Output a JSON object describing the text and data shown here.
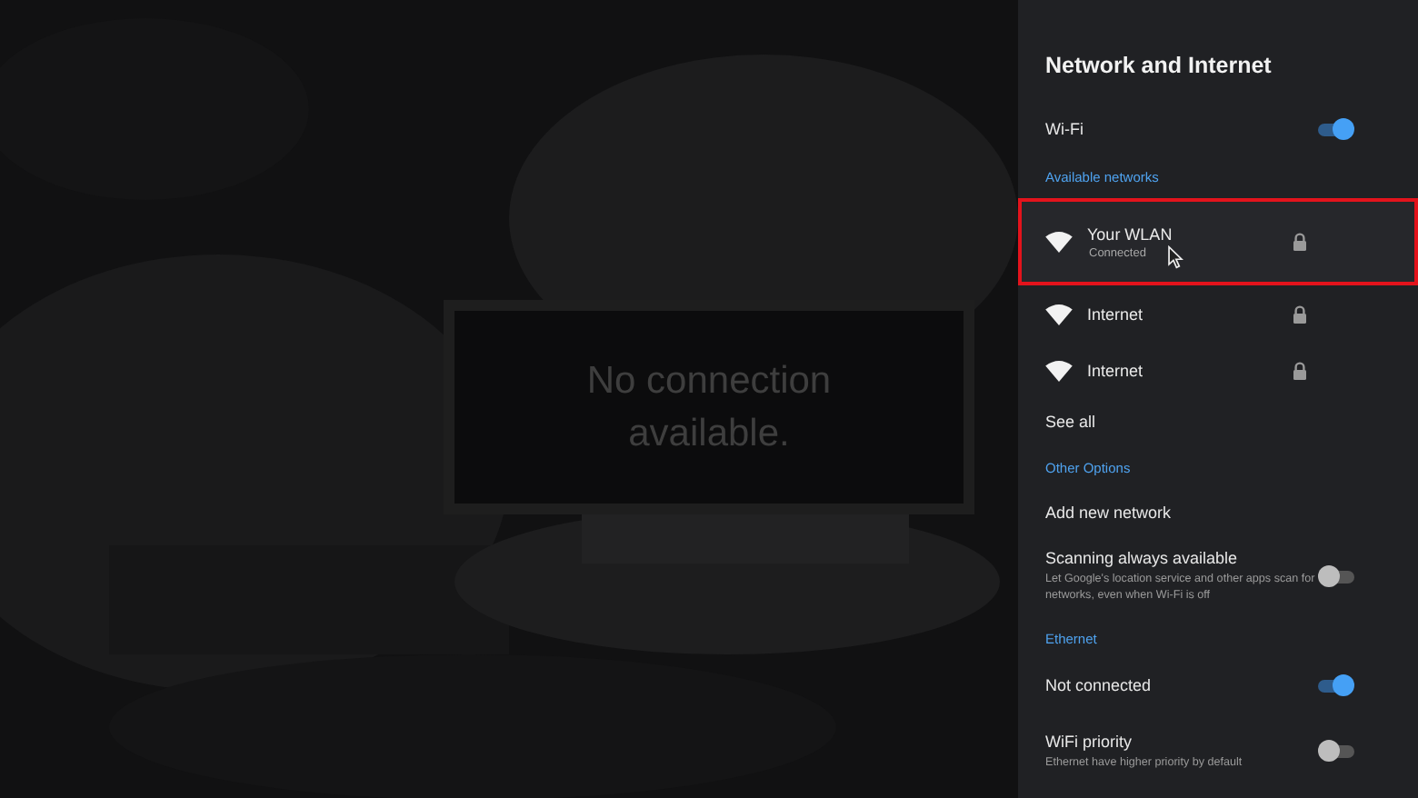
{
  "message": "No connection available.",
  "panel": {
    "title": "Network and Internet",
    "items": [
      {
        "kind": "toggle",
        "label": "Wi-Fi",
        "on": true
      },
      {
        "kind": "header",
        "label": "Available networks"
      },
      {
        "kind": "network",
        "name": "Your WLAN",
        "status": "Connected",
        "locked": true,
        "selected": true
      },
      {
        "kind": "network",
        "name": "Internet",
        "locked": true,
        "selected": false
      },
      {
        "kind": "network",
        "name": "Internet",
        "locked": true,
        "selected": false
      },
      {
        "kind": "link",
        "label": "See all"
      },
      {
        "kind": "header",
        "label": "Other Options"
      },
      {
        "kind": "link",
        "label": "Add new network"
      },
      {
        "kind": "toggle",
        "label": "Scanning always available",
        "description": "Let Google's location service and other apps scan for networks, even when Wi-Fi is off",
        "on": false
      },
      {
        "kind": "header",
        "label": "Ethernet"
      },
      {
        "kind": "toggle",
        "label": "Not connected",
        "on": true
      },
      {
        "kind": "toggle",
        "label": "WiFi priority",
        "description": "Ethernet have higher priority by default",
        "on": false
      }
    ]
  }
}
